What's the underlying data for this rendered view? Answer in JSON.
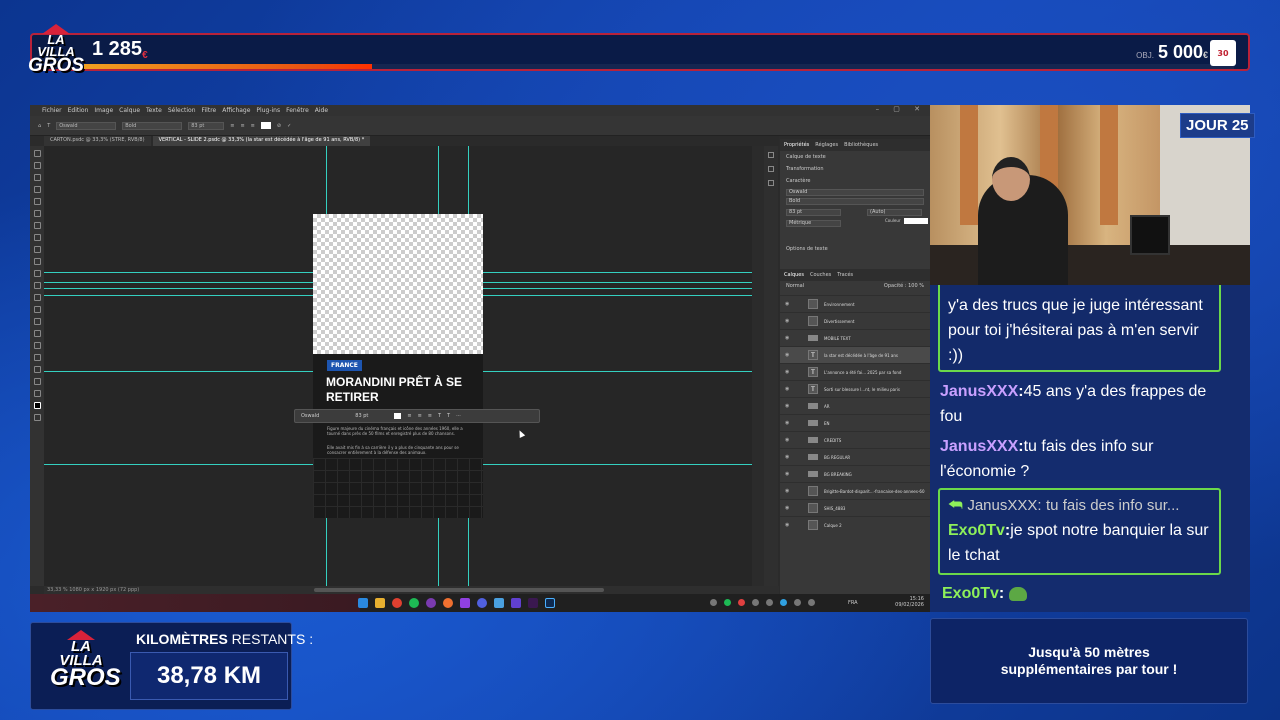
{
  "overlay": {
    "logo_line1": "LA VILLA",
    "logo_line2": "GROS",
    "counter_value": "1 285",
    "counter_unit": "€",
    "progress_fraction": 0.25,
    "goal_label": "OBJ.",
    "goal_value": "5 000",
    "goal_unit": "€",
    "day_badge": "JOUR 25",
    "km_label_bold": "KILOMÈTRES",
    "km_label_rest": "RESTANTS :",
    "km_value": "38,78 KM",
    "info_text": "Jusqu'à 50 mètres supplémentaires par tour !"
  },
  "photoshop": {
    "menu": [
      "Fichier",
      "Edition",
      "Image",
      "Calque",
      "Texte",
      "Sélection",
      "Filtre",
      "Affichage",
      "Plug-ins",
      "Fenêtre",
      "Aide"
    ],
    "options": {
      "font": "Oswald",
      "style": "Bold",
      "size": "83 pt"
    },
    "tabs": [
      "CARTON.psdc @ 33,3% (STRE, RVB/8)",
      "VERTICAL - SLIDE 2.psdc @ 33,3% (la star est décédée à l'âge de 91 ans, RVB/8) *"
    ],
    "doc": {
      "tag": "FRANCE",
      "headline": "MORANDINI PRÊT À SE RETIRER",
      "body1": "Figure majeure du cinéma français et icône des années 1960, elle a tourné dans près de 50 films et enregistré plus de 80 chansons.",
      "body2": "Elle avait mis fin à sa carrière il y a plus de cinquante ans pour se consacrer entièrement à la défense des animaux."
    },
    "floatbar": {
      "font": "Oswald",
      "size": "83 pt"
    },
    "status": "33,33 %    1080 px x 1920 px (72 ppp)",
    "panel_tabs": [
      "Propriétés",
      "Réglages",
      "Bibliothèques"
    ],
    "panel_layer_kind": "Calque de texte",
    "panel_transform": "Transformation",
    "panel_char": "Caractère",
    "panel_font": "Oswald",
    "panel_style": "Bold",
    "panel_size": "83 pt",
    "panel_lead": "(Auto)",
    "panel_kern": "Métrique",
    "panel_color": "Couleur",
    "panel_textopts": "Options de texte",
    "layers_tabs": [
      "Calques",
      "Couches",
      "Tracés"
    ],
    "layers_mode": "Normal",
    "layers_opacity": "Opacité : 100 %",
    "layers": [
      {
        "name": "Environnement",
        "kind": "thumb"
      },
      {
        "name": "Divertissement",
        "kind": "thumb"
      },
      {
        "name": "MOBILE TEXT",
        "kind": "folder"
      },
      {
        "name": "la star est décédée à l'âge de 91 ans",
        "kind": "text",
        "selected": true
      },
      {
        "name": "L'annonce a été fai... 2025 par sa fond",
        "kind": "text"
      },
      {
        "name": "Sorti sur blessure l...nt, le milieu paris",
        "kind": "text"
      },
      {
        "name": "AR",
        "kind": "folder"
      },
      {
        "name": "EN",
        "kind": "folder"
      },
      {
        "name": "CREDITS",
        "kind": "folder"
      },
      {
        "name": "BG REGULAR",
        "kind": "folder"
      },
      {
        "name": "BG BREAKING",
        "kind": "folder"
      },
      {
        "name": "Brigitte-Bardot-disparit...-francaise-des-annees-60",
        "kind": "thumb"
      },
      {
        "name": "SHIS_4883",
        "kind": "thumb"
      },
      {
        "name": "Calque 2",
        "kind": "thumb"
      }
    ],
    "tray_lang": "FRA",
    "clock_time": "15:16",
    "clock_date": "09/02/2026"
  },
  "chat": {
    "m1_text": "y'a des trucs que je juge intéressant pour toi j'hésiterai pas à m'en servir :))",
    "m2_user": "JanusXXX",
    "m2_text": "45 ans y'a des frappes de fou",
    "m3_user": "JanusXXX",
    "m3_text": "tu fais des info sur l'économie ?",
    "m4_reply_user": "JanusXXX:",
    "m4_reply_text": "tu fais des info sur...",
    "m4_user": "Exo0Tv",
    "m4_text": "je spot notre banquier la sur le tchat",
    "m5_user": "Exo0Tv",
    "colors": {
      "highlight": "#6bd84a",
      "user_purple": "#c9a0ff",
      "user_green": "#8ef05a"
    }
  }
}
